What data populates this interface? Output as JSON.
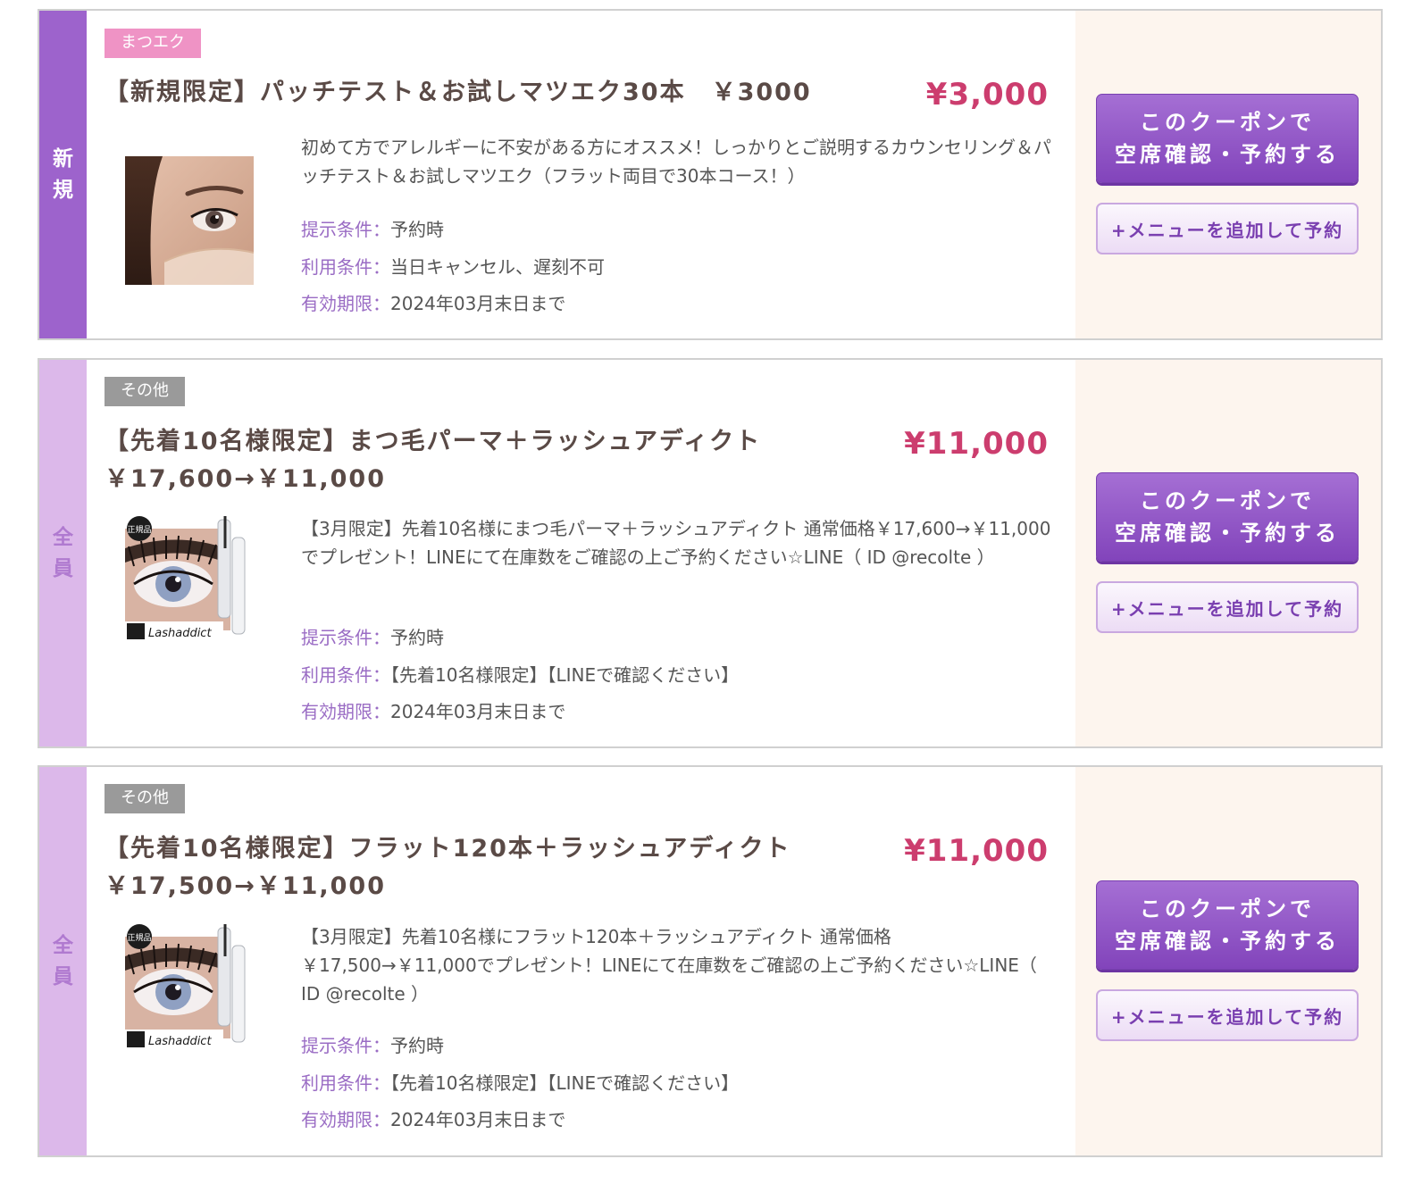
{
  "coupons": [
    {
      "target": "新規",
      "category": "まつエク",
      "title": "【新規限定】パッチテスト＆お試しマツエク30本　￥3000",
      "price": "¥3,000",
      "description": "初めて方でアレルギーに不安がある方にオススメ！しっかりとご説明するカウンセリング＆パッチテスト＆お試しマツエク（フラット両目で30本コース！）",
      "conditions": [
        {
          "label": "提示条件",
          "value": "予約時"
        },
        {
          "label": "利用条件",
          "value": "当日キャンセル、遅刻不可"
        },
        {
          "label": "有効期限",
          "value": "2024年03月末日まで"
        }
      ],
      "reserve_label": "このクーポンで\n空席確認・予約する",
      "add_menu_label": "+メニューを追加して予約"
    },
    {
      "target": "全員",
      "category": "その他",
      "title": "【先着10名様限定】まつ毛パーマ＋ラッシュアディクト ￥17,600→￥11,000",
      "price": "¥11,000",
      "description": "【3月限定】先着10名様にまつ毛パーマ＋ラッシュアディクト 通常価格￥17,600→￥11,000でプレゼント！LINEにて在庫数をご確認の上ご予約ください☆LINE（ ID @recolte ）",
      "conditions": [
        {
          "label": "提示条件",
          "value": "予約時"
        },
        {
          "label": "利用条件",
          "value": "【先着10名様限定】【LINEで確認ください】"
        },
        {
          "label": "有効期限",
          "value": "2024年03月末日まで"
        }
      ],
      "reserve_label": "このクーポンで\n空席確認・予約する",
      "add_menu_label": "+メニューを追加して予約",
      "thumb_badge": "正規品",
      "thumb_brand": "Lashaddict"
    },
    {
      "target": "全員",
      "category": "その他",
      "title": "【先着10名様限定】フラット120本＋ラッシュアディクト ￥17,500→￥11,000",
      "price": "¥11,000",
      "description": "【3月限定】先着10名様にフラット120本＋ラッシュアディクト 通常価格￥17,500→￥11,000でプレゼント！LINEにて在庫数をご確認の上ご予約ください☆LINE（ ID @recolte ）",
      "conditions": [
        {
          "label": "提示条件",
          "value": "予約時"
        },
        {
          "label": "利用条件",
          "value": "【先着10名様限定】【LINEで確認ください】"
        },
        {
          "label": "有効期限",
          "value": "2024年03月末日まで"
        }
      ],
      "reserve_label": "このクーポンで\n空席確認・予約する",
      "add_menu_label": "+メニューを追加して予約",
      "thumb_badge": "正規品",
      "thumb_brand": "Lashaddict"
    }
  ],
  "colors": {
    "accent_purple": "#9d63cc",
    "light_purple": "#dcb8ea",
    "price_red": "#cc3d6e",
    "panel_bg": "#fdf5ee",
    "tag_pink": "#ef93c5",
    "tag_gray": "#9a9a9a"
  }
}
